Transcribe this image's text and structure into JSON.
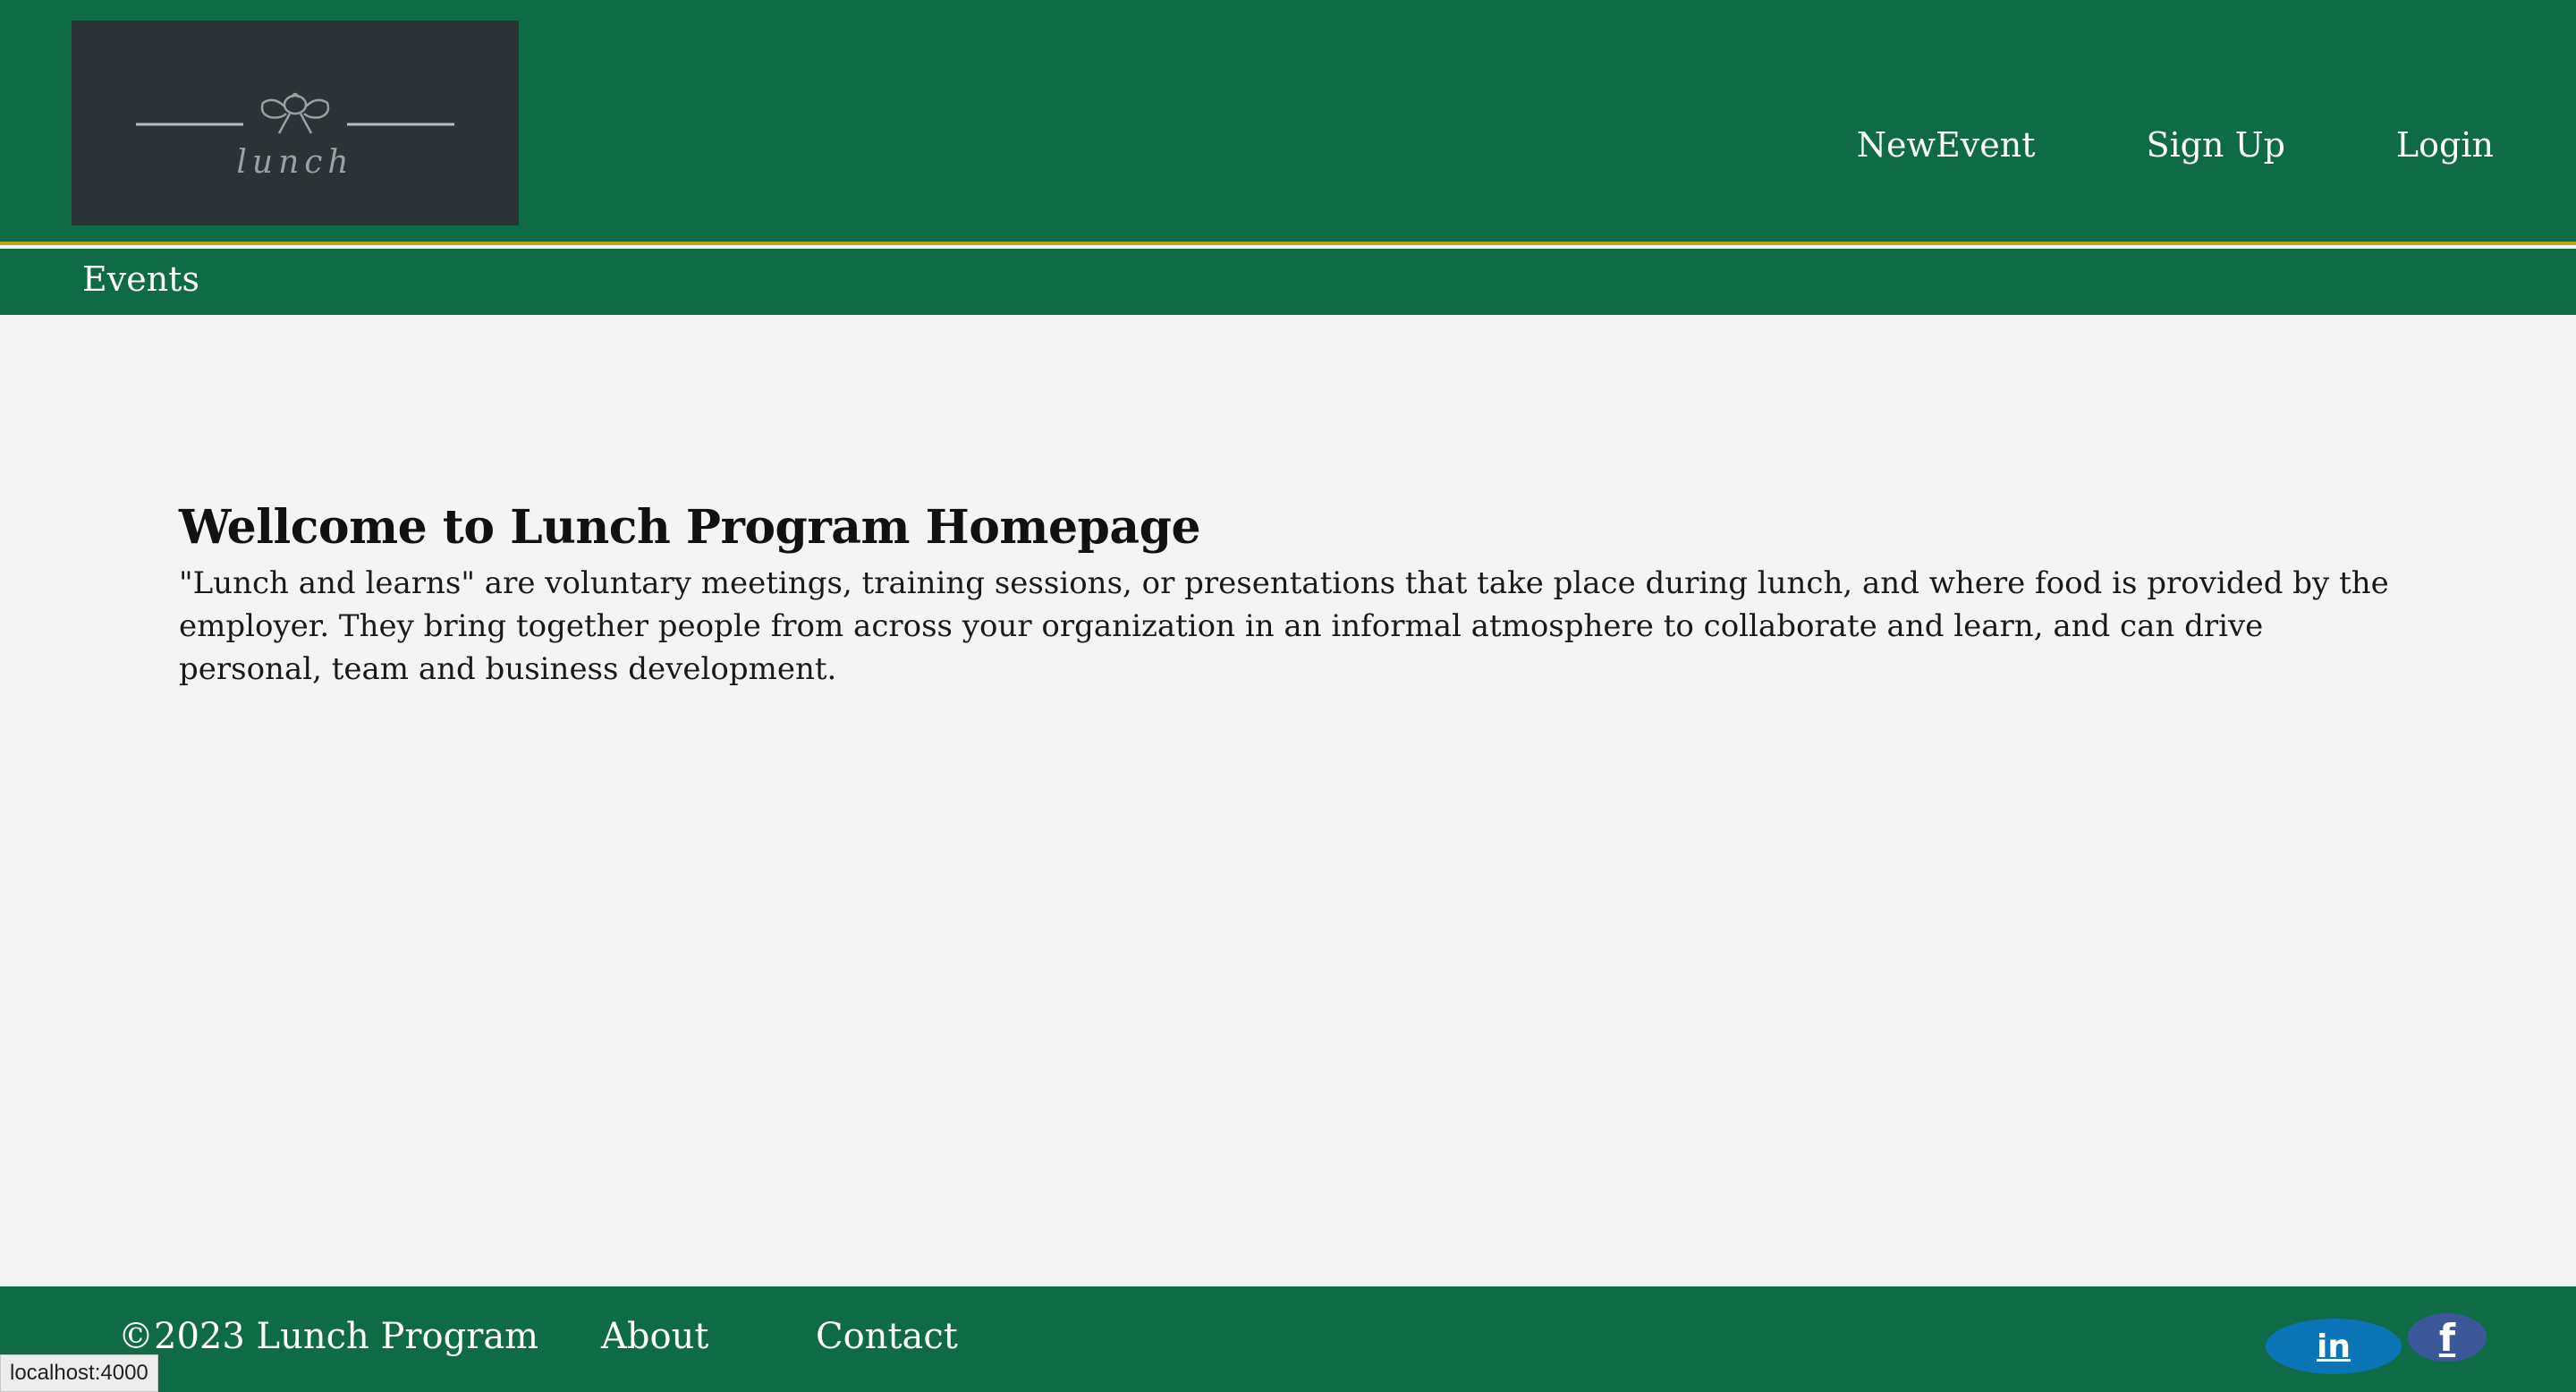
{
  "header": {
    "logo_text": "lunch",
    "nav": {
      "new_event": "NewEvent",
      "sign_up": "Sign Up",
      "login": "Login"
    }
  },
  "subbar": {
    "events": "Events"
  },
  "main": {
    "title": "Wellcome to Lunch Program Homepage",
    "body": "\"Lunch and learns\" are voluntary meetings, training sessions, or presentations that take place during lunch, and where food is provided by the employer. They bring together people from across your organization in an informal atmosphere to collaborate and learn, and can drive personal, team and business development."
  },
  "footer": {
    "copyright": "©2023 Lunch Program",
    "about": "About",
    "contact": "Contact",
    "linkedin_label": "in",
    "facebook_label": "f"
  },
  "status": {
    "url": "localhost:4000"
  },
  "colors": {
    "header_bg": "#0e6b46",
    "accent_border": "#b8a42b",
    "logo_bg": "#2c3337",
    "page_bg": "#f4f4f4",
    "linkedin": "#0a76b8",
    "facebook": "#3b5998"
  },
  "icons": {
    "logo": "lunch-logo-icon",
    "linkedin": "linkedin-icon",
    "facebook": "facebook-icon"
  }
}
